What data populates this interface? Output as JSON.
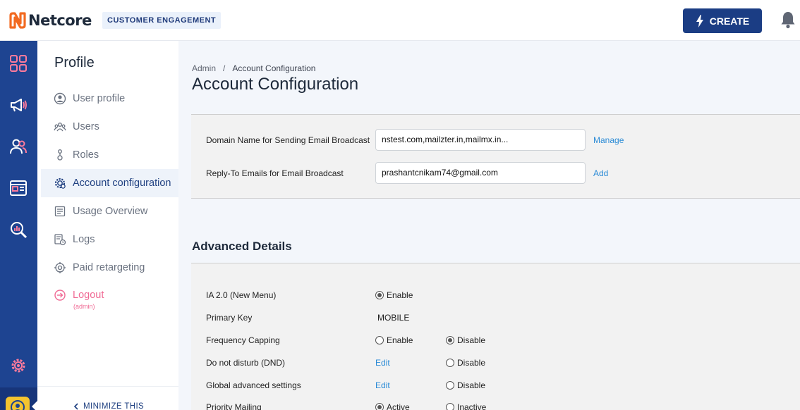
{
  "brand": {
    "name": "Netcore",
    "product_badge": "CUSTOMER ENGAGEMENT",
    "accent": "#1b3d84",
    "logo_color": "#f26a21"
  },
  "header": {
    "create_label": "CREATE"
  },
  "rail": {
    "icons": [
      "dashboard-icon",
      "megaphone-icon",
      "users-icon",
      "browser-window-icon",
      "analytics-search-icon",
      "settings-icon",
      "profile-avatar-icon"
    ]
  },
  "sidenav": {
    "title": "Profile",
    "items": [
      {
        "label": "User profile",
        "icon": "user-circle-icon"
      },
      {
        "label": "Users",
        "icon": "users-group-icon"
      },
      {
        "label": "Roles",
        "icon": "role-icon"
      },
      {
        "label": "Account configuration",
        "icon": "gear-cog-icon",
        "active": true
      },
      {
        "label": "Usage Overview",
        "icon": "usage-list-icon"
      },
      {
        "label": "Logs",
        "icon": "logs-clock-icon"
      },
      {
        "label": "Paid retargeting",
        "icon": "target-icon"
      }
    ],
    "logout": {
      "label": "Logout",
      "sub": "(admin)"
    },
    "minimize_label": "MINIMIZE THIS"
  },
  "breadcrumb": {
    "parent": "Admin",
    "separator": "/",
    "current": "Account Configuration"
  },
  "page": {
    "title": "Account Configuration"
  },
  "email_config": {
    "domain": {
      "label": "Domain Name for Sending Email Broadcast",
      "value": "nstest.com,mailzter.in,mailmx.in...",
      "action": "Manage"
    },
    "reply_to": {
      "label": "Reply-To Emails for Email Broadcast",
      "value": "prashantcnikam74@gmail.com",
      "action": "Add"
    }
  },
  "advanced": {
    "title": "Advanced Details",
    "rows": [
      {
        "label": "IA 2.0 (New Menu)",
        "option1": "Enable",
        "option1_checked": true
      },
      {
        "label": "Primary Key",
        "value": "MOBILE"
      },
      {
        "label": "Frequency Capping",
        "option1": "Enable",
        "option1_checked": false,
        "option2": "Disable",
        "option2_checked": true
      },
      {
        "label": "Do not disturb (DND)",
        "link": "Edit",
        "option2": "Disable",
        "option2_checked": false
      },
      {
        "label": "Global advanced settings",
        "link": "Edit",
        "option2": "Disable",
        "option2_checked": false
      },
      {
        "label": "Priority Mailing",
        "option1": "Active",
        "option1_checked": true,
        "option2": "Inactive",
        "option2_checked": false
      }
    ]
  }
}
